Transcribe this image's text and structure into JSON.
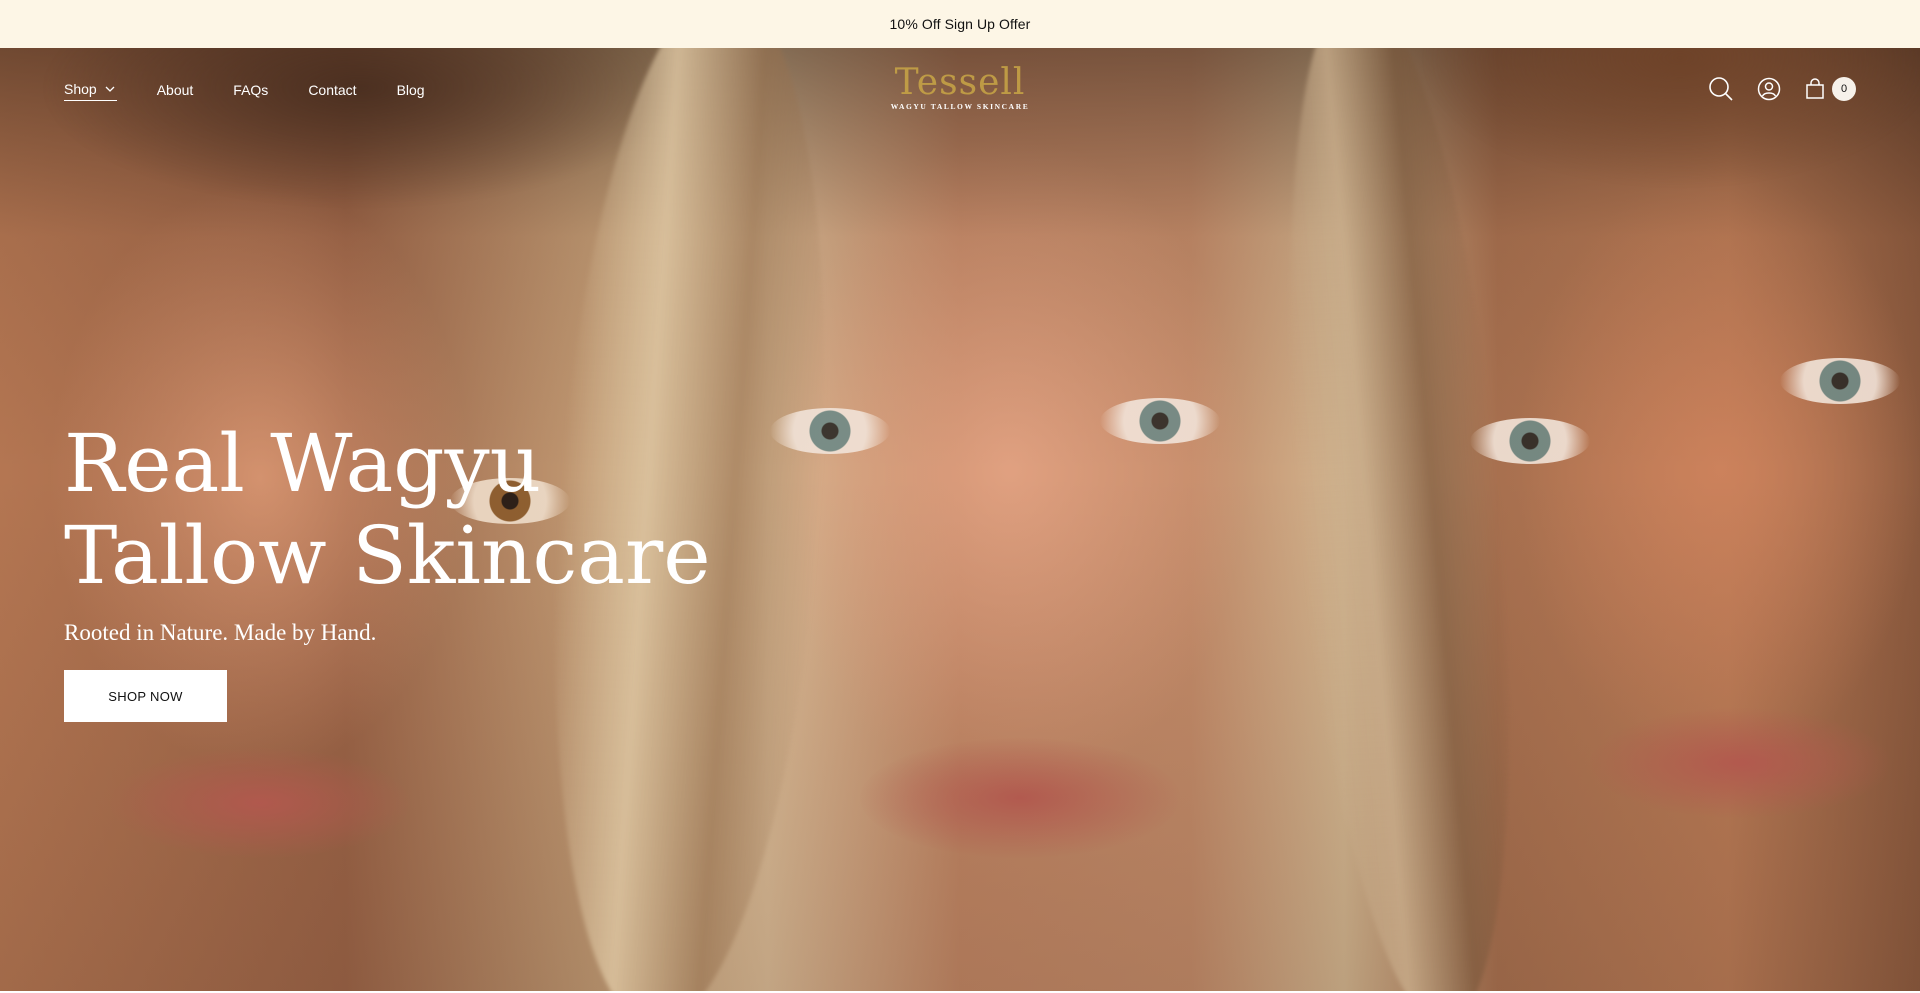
{
  "announcement": {
    "text": "10% Off Sign Up Offer"
  },
  "nav": {
    "links": [
      {
        "label": "Shop",
        "has_dropdown": true,
        "active": true
      },
      {
        "label": "About"
      },
      {
        "label": "FAQs"
      },
      {
        "label": "Contact"
      },
      {
        "label": "Blog"
      }
    ],
    "logo": {
      "word": "Tessell",
      "tagline": "WAGYU TALLOW SKINCARE"
    },
    "icons": [
      "search-icon",
      "account-icon",
      "cart-icon"
    ],
    "cart_count": "0"
  },
  "hero": {
    "title": "Real Wagyu Tallow Skincare",
    "subtitle": "Rooted in Nature. Made by Hand.",
    "cta_label": "SHOP NOW"
  },
  "colors": {
    "announcement_bg": "#fdf6e6",
    "logo_gold": "#c9a646",
    "text_light": "#ffffff",
    "button_bg": "#ffffff"
  }
}
